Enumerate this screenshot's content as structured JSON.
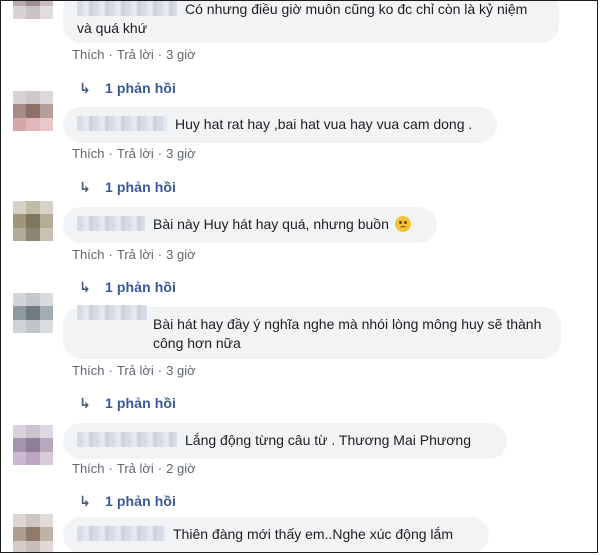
{
  "comments": [
    {
      "text": "Có nhưng điều giờ muôn cũng ko đc chỉ còn là kỷ niệm và quá khứ",
      "actions": {
        "like": "Thích",
        "reply": "Trả lời",
        "time": "3 giờ"
      },
      "replies": "1 phản hồi"
    },
    {
      "text": "Huy hat rat hay ,bai hat vua hay vua cam dong .",
      "actions": {
        "like": "Thích",
        "reply": "Trả lời",
        "time": "3 giờ"
      },
      "replies": "1 phản hồi"
    },
    {
      "text": "Bài này Huy hát hay quá, nhưng buồn",
      "emoji": "sad-face-icon",
      "actions": {
        "like": "Thích",
        "reply": "Trả lời",
        "time": "3 giờ"
      },
      "replies": "1 phản hồi"
    },
    {
      "text": "Bài hát hay đầy ý nghĩa nghe mà nhói lòng mông huy sẽ thành công hơn nữa",
      "actions": {
        "like": "Thích",
        "reply": "Trả lời",
        "time": "3 giờ"
      },
      "replies": "1 phản hồi"
    },
    {
      "text": "Lắng động từng câu từ . Thương Mai Phương",
      "actions": {
        "like": "Thích",
        "reply": "Trả lời",
        "time": "2 giờ"
      },
      "replies": "1 phản hồi"
    },
    {
      "text": "Thiên đàng mới thấy em..Nghe xúc động lắm"
    }
  ],
  "separator": "·",
  "colors": {
    "bubble": "#f2f3f5",
    "link": "#385898",
    "meta": "#606770"
  }
}
